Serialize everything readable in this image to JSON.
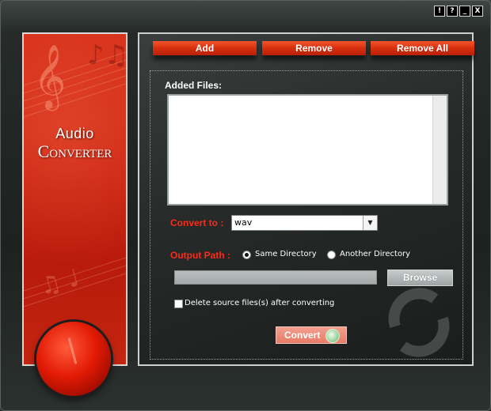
{
  "window_controls": [
    "!",
    "?",
    "_",
    "X"
  ],
  "banner": {
    "title_line1": "Audio",
    "title_line2": "Converter"
  },
  "toolbar": {
    "add_label": "Add",
    "remove_label": "Remove",
    "remove_all_label": "Remove All"
  },
  "files": {
    "label": "Added Files:",
    "items": []
  },
  "convert_to": {
    "label": "Convert to :",
    "selected": "wav"
  },
  "output_path": {
    "label": "Output Path :",
    "options": [
      {
        "label": "Same Directory",
        "checked": true
      },
      {
        "label": "Another Directory",
        "checked": false
      }
    ],
    "path_value": "",
    "browse_label": "Browse"
  },
  "delete_source": {
    "label": "Delete source files(s) after converting",
    "checked": false
  },
  "convert_button": {
    "label": "Convert"
  },
  "colors": {
    "accent_red": "#d62f0e",
    "label_red": "#ff2a1a",
    "panel_dark": "#262a29"
  }
}
